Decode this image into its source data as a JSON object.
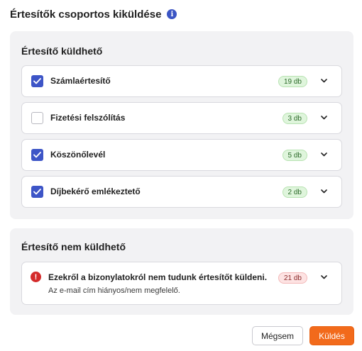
{
  "header": {
    "title": "Értesítők csoportos kiküldése",
    "info_icon": "info-icon",
    "info_glyph": "i"
  },
  "sendable": {
    "title": "Értesítő küldhető",
    "items": [
      {
        "label": "Számlaértesítő",
        "count": "19 db",
        "checked": true
      },
      {
        "label": "Fizetési felszólítás",
        "count": "3 db",
        "checked": false
      },
      {
        "label": "Köszönőlevél",
        "count": "5 db",
        "checked": true
      },
      {
        "label": "Díjbekérő emlékeztető",
        "count": "2 db",
        "checked": true
      }
    ]
  },
  "not_sendable": {
    "title": "Értesítő nem küldhető",
    "warning_glyph": "!",
    "warning_title": "Ezekről a bizonylatokról nem tudunk értesítőt küldeni.",
    "warning_sub": "Az e-mail cím hiányos/nem megfelelő.",
    "count": "21 db"
  },
  "buttons": {
    "cancel": "Mégsem",
    "send": "Küldés"
  },
  "colors": {
    "accent": "#3d55c7",
    "send": "#f26a1b",
    "error": "#d42b2b"
  }
}
